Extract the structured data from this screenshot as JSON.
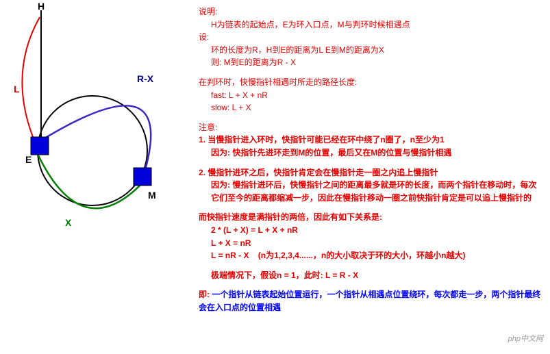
{
  "diagram": {
    "nodes": {
      "H": "H",
      "E": "E",
      "M": "M"
    },
    "edges": {
      "L": "L",
      "RX": "R-X",
      "X": "X"
    }
  },
  "explanation": {
    "title": "说明:",
    "line1": "H为链表的起始点，E为环入口点，M与判环时候相遇点",
    "set": "设:",
    "set1": "环的长度为R，H到E的距离为L  E到M的距离为X",
    "set2": "则:  M到E的距离为R - X"
  },
  "meeting": {
    "title": "在判环时，快慢指针相遇时所走的路径长度:",
    "fast": "fast: L + X + nR",
    "slow": "slow: L + X"
  },
  "notice": {
    "title": "注意:",
    "p1": "1. 当慢指针进入环时，快指针可能已经在环中绕了n圈了，n至少为1",
    "p1reason": "因为: 快指针先进环走到M的位置，最后又在M的位置与慢指针相遇",
    "p2": "2. 慢指针进环之后，快指针肯定会在慢指针走一圈之内追上慢指针",
    "p2reason": "因为: 慢指针进环后，快慢指针之间的距离最多就是环的长度，而两个指针在移动时，每次它们至今的距离都缩减一步，因此在慢指针移动一圈之前快指针肯定是可以追上慢指针的"
  },
  "derivation": {
    "title": "而快指针速度是满指针的两倍，因此有如下关系是:",
    "eq1": "2 * (L + X) = L + X + nR",
    "eq2": "L + X = nR",
    "eq3": "L = nR - X",
    "eq3note": "(n为1,2,3,4......，n的大小取决于环的大小，环越小n越大)"
  },
  "extreme": {
    "text": "极端情况下，假设n = 1，此时:  L = R - X"
  },
  "conclusion": {
    "title": "即:",
    "text": "一个指针从链表起始位置运行，一个指针从相遇点位置绕环，每次都走一步，两个指针最终会在入口点的位置相遇"
  },
  "watermark": "php中文网"
}
